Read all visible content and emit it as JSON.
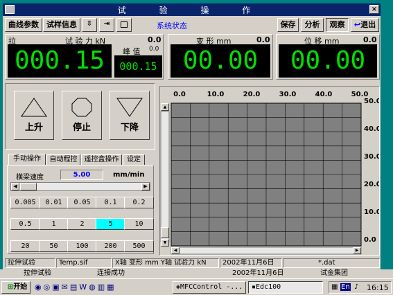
{
  "window": {
    "title": "试 验 操 作",
    "close_label": "×"
  },
  "toolbar": {
    "curve_params": "曲线参数",
    "sample_info": "试样信息",
    "system_status": "系统状态",
    "save": "保存",
    "analyze": "分析",
    "observe": "观察",
    "exit": "退出"
  },
  "readouts": {
    "force": {
      "prefix": "拉",
      "label": "试 验 力 kN",
      "small_value": "0.0",
      "value": "000.15"
    },
    "peak": {
      "label": "峰 值",
      "small_value": "0.0",
      "value": "000.15"
    },
    "deform": {
      "label": "变 形 mm",
      "small_value": "0.0",
      "value": "00.00"
    },
    "displace": {
      "label": "位 移 mm",
      "small_value": "0.0",
      "value": "00.00"
    }
  },
  "controls": {
    "up": "上升",
    "stop": "停止",
    "down": "下降"
  },
  "tabs": [
    "手动操作",
    "自动程控",
    "遥控盒操作",
    "设定"
  ],
  "speed": {
    "label": "横梁速度",
    "value": "5.00",
    "unit": "mm/min"
  },
  "speed_buttons": {
    "row1": [
      "0.005",
      "0.01",
      "0.05",
      "0.1",
      "0.2"
    ],
    "row2": [
      "0.5",
      "1",
      "2",
      "5",
      "10"
    ],
    "row3": [
      "20",
      "50",
      "100",
      "200",
      "500"
    ],
    "selected": "5"
  },
  "chart_data": {
    "type": "line",
    "x_ticks": [
      "0.0",
      "10.0",
      "20.0",
      "30.0",
      "40.0",
      "50.0"
    ],
    "y_ticks": [
      "50.0",
      "40.0",
      "30.0",
      "20.0",
      "10.0",
      "0.0"
    ],
    "xlim": [
      0,
      50
    ],
    "ylim": [
      0,
      50
    ],
    "grid": true,
    "series": []
  },
  "status": {
    "test_type": "拉伸试验",
    "file": "Temp.sif",
    "axes": "X轴 变形 mm Y轴 试验力 kN",
    "date": "2002年11月6日",
    "ext": "*.dat"
  },
  "behind": {
    "left": "拉伸试验",
    "mid": "连接成功",
    "date": "2002年11月6日",
    "right": "试金集团"
  },
  "taskbar": {
    "start": "开始",
    "task1": "MFCControl -...",
    "task2": "Edc100",
    "lang": "En",
    "clock": "16:15"
  },
  "colors": {
    "titlebar": "#0a246a",
    "lcd_fg": "#00e000",
    "lcd_bg": "#000000",
    "chart_bg": "#808080",
    "selected": "#00ffff",
    "speed_value": "#0000ff"
  }
}
